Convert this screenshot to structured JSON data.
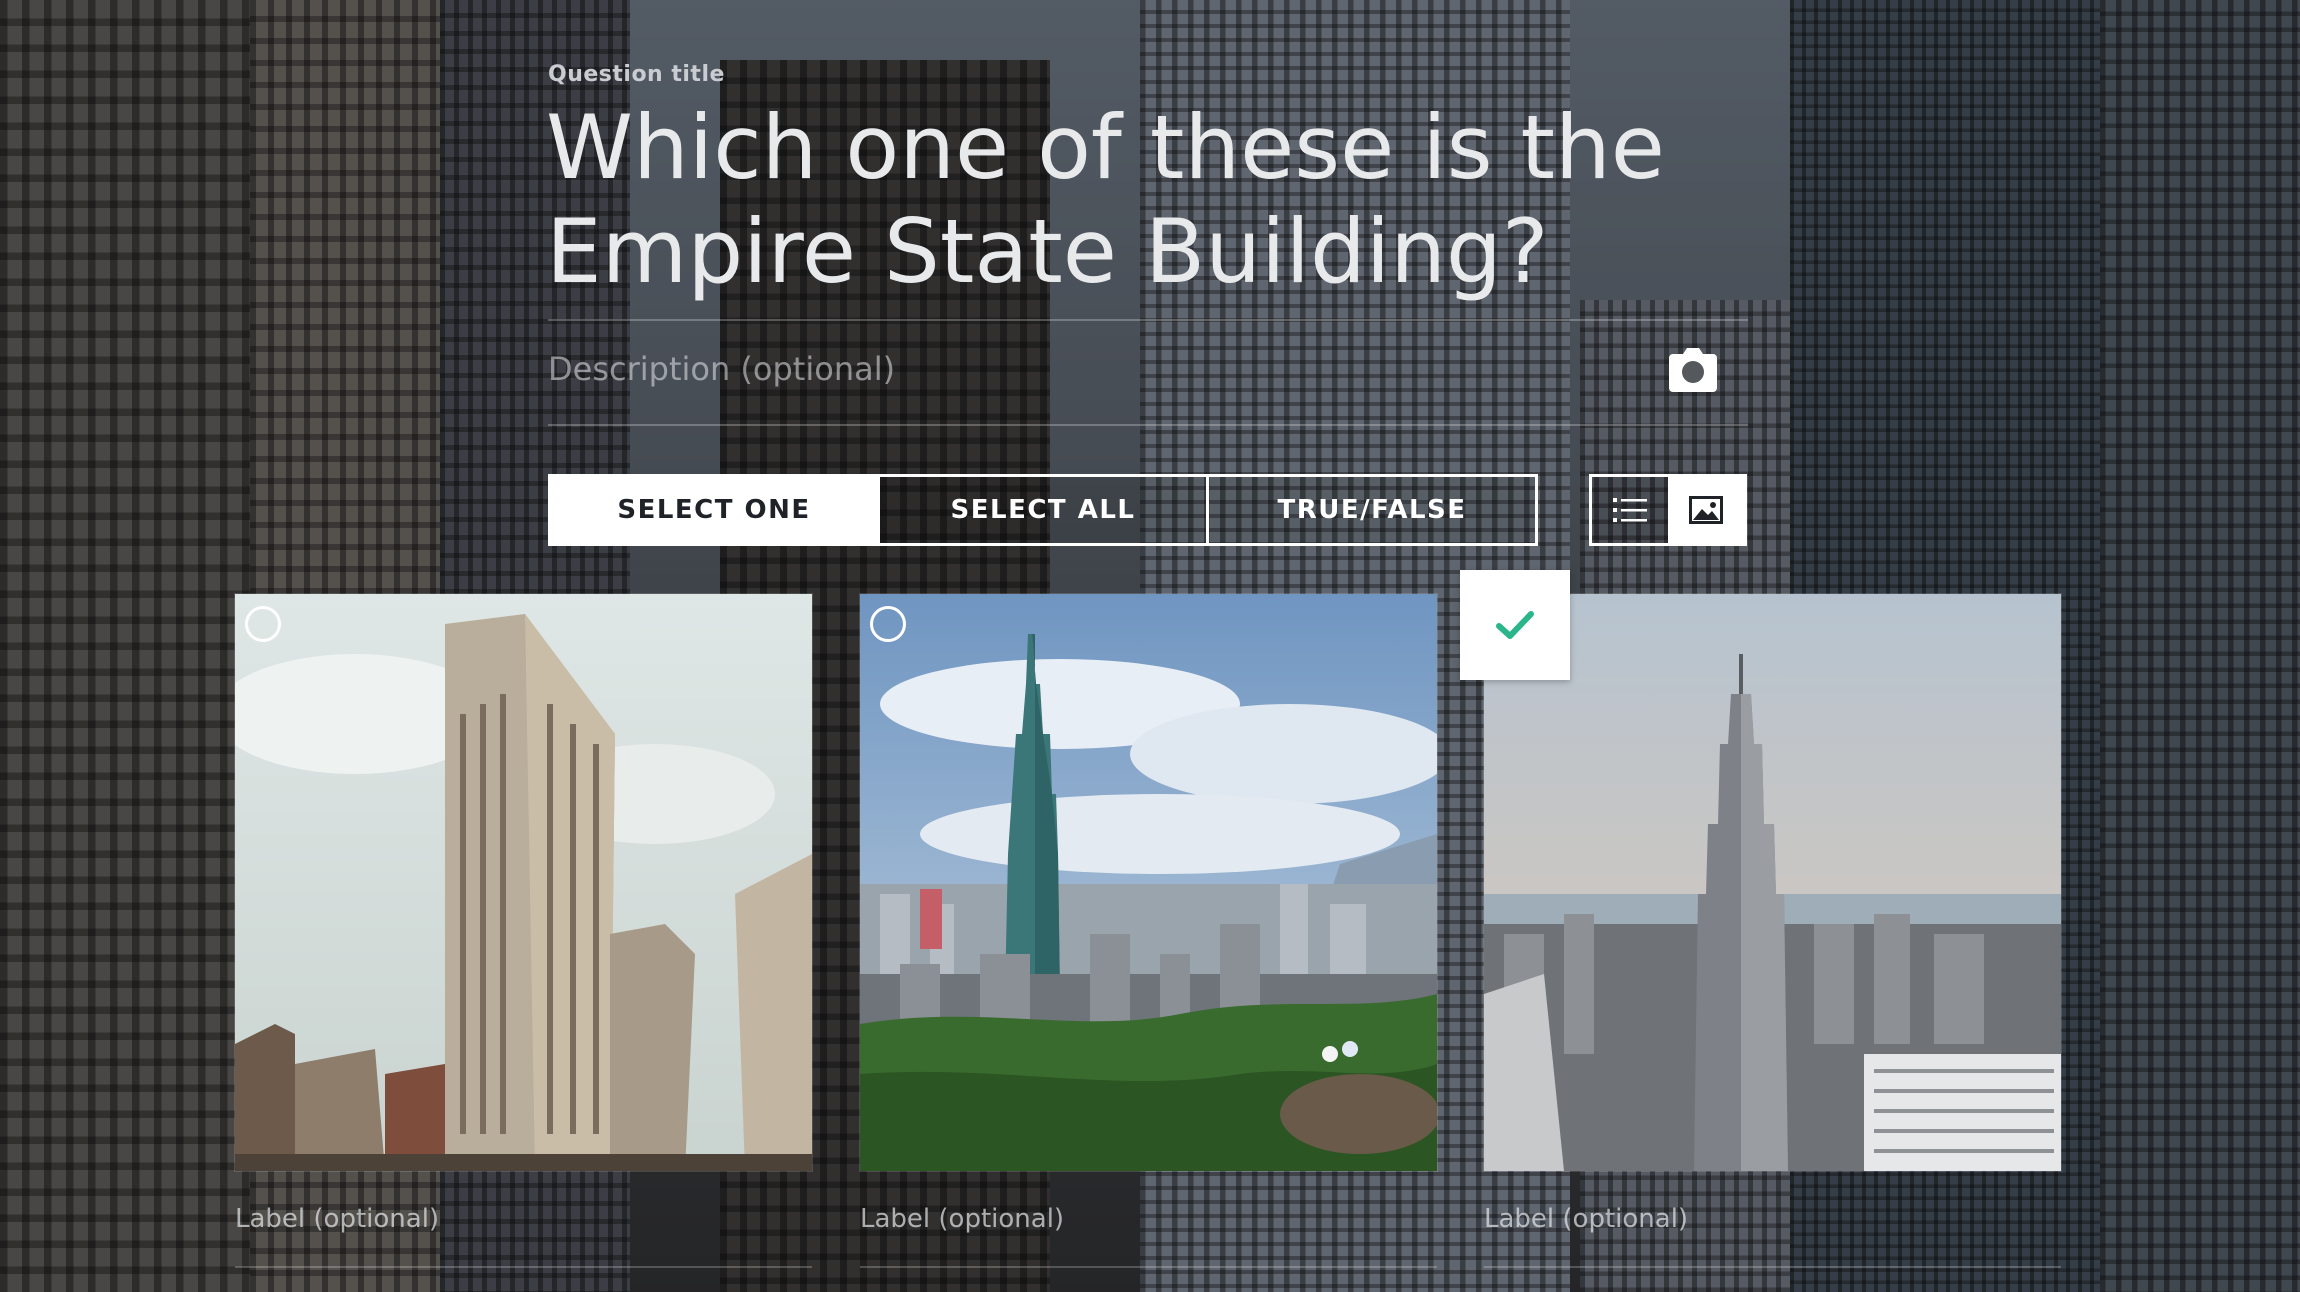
{
  "question": {
    "title_label": "Question title",
    "title": "Which one of these is the Empire State Building?",
    "description_placeholder": "Description (optional)"
  },
  "question_type": {
    "options": [
      "SELECT ONE",
      "SELECT ALL",
      "TRUE/FALSE"
    ],
    "selected": "SELECT ONE"
  },
  "layout_toggle": {
    "options": [
      "list-icon",
      "image-icon"
    ],
    "selected": "image-icon"
  },
  "answers": [
    {
      "image": "flatiron-building",
      "label_placeholder": "Label (optional)",
      "correct": false
    },
    {
      "image": "taipei-101",
      "label_placeholder": "Label (optional)",
      "correct": false
    },
    {
      "image": "empire-state-building",
      "label_placeholder": "Label (optional)",
      "correct": true
    }
  ],
  "colors": {
    "check": "#2bb58a",
    "text_on_image": "#e8e9eb"
  }
}
